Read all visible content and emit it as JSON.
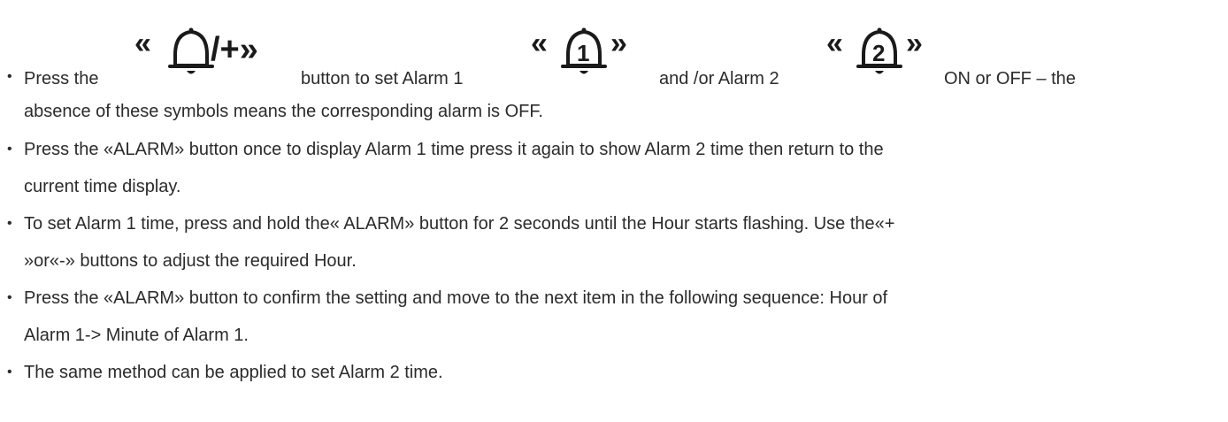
{
  "bullet": "•",
  "item1": {
    "prefix": "Press the",
    "symbol_main": "«  /+»",
    "symbol_main_icon": "bell-icon",
    "mid1": "button to set Alarm 1",
    "symbol_alarm1_left": "«",
    "symbol_alarm1_digit": "1",
    "symbol_alarm1_right": "»",
    "mid2": "and /or Alarm 2",
    "symbol_alarm2_left": "«",
    "symbol_alarm2_digit": "2",
    "symbol_alarm2_right": "»",
    "suffix": "ON or OFF – the",
    "continuation": "absence of these symbols means the corresponding alarm is OFF."
  },
  "items": [
    {
      "line1": "Press the «ALARM» button once to display Alarm 1 time press it again to show Alarm 2 time then return to the",
      "line2": "current time display."
    },
    {
      "line1": "To set Alarm 1 time, press and hold the« ALARM» button for 2 seconds until the Hour starts flashing. Use the«+",
      "line2": "»or«-» buttons to adjust the required Hour."
    },
    {
      "line1": "Press the «ALARM» button to confirm the setting and move to the next item in the following sequence: Hour of",
      "line2": "Alarm 1-> Minute of Alarm 1."
    },
    {
      "line1": "The same method can be applied to set Alarm 2 time."
    }
  ]
}
